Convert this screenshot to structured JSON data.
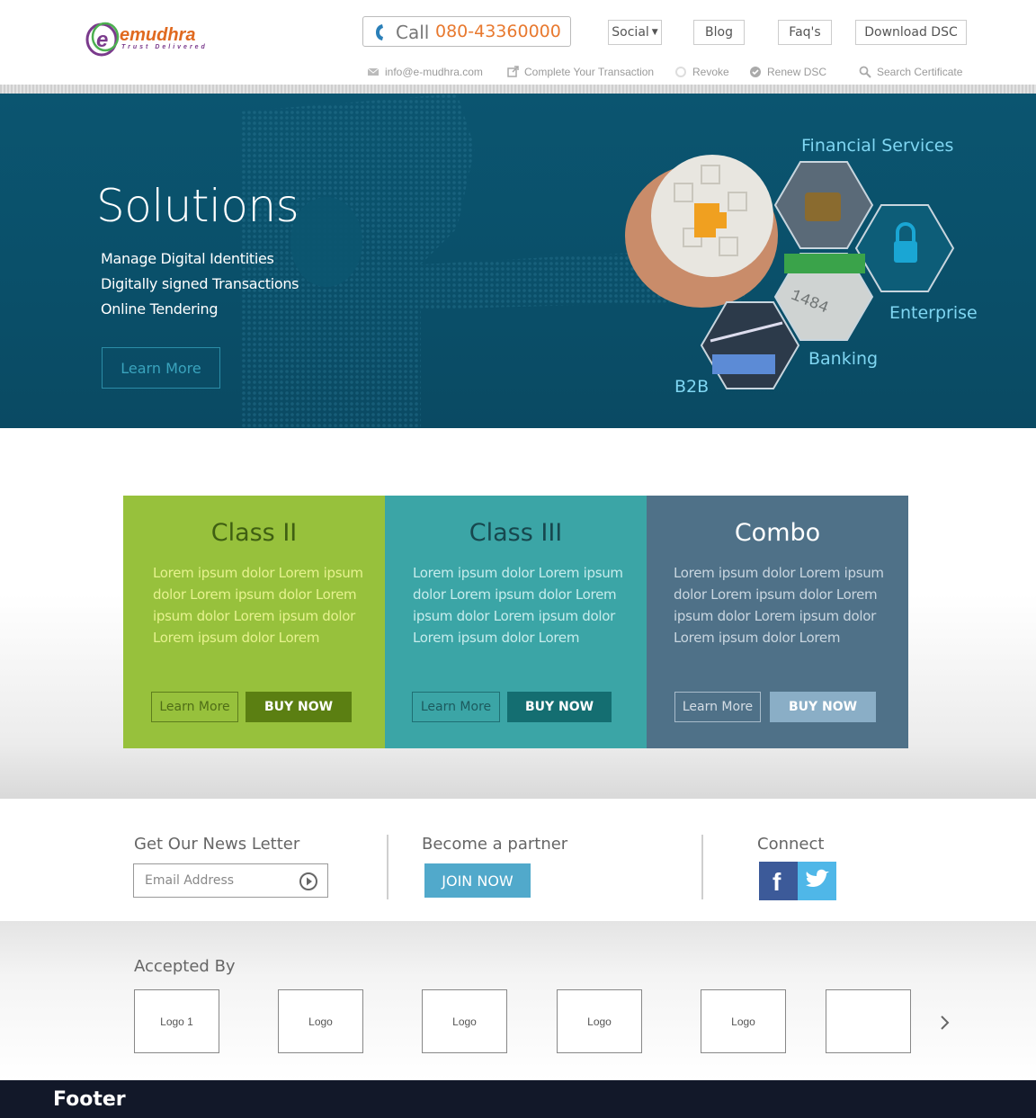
{
  "brand": {
    "name": "emudhra",
    "tagline": "Trust Delivered",
    "letter": "e"
  },
  "header": {
    "call_label": "Call",
    "call_number": "080-43360000",
    "nav": [
      "Social",
      "Blog",
      "Faq's",
      "Download DSC"
    ],
    "subnav": {
      "email": "info@e-mudhra.com",
      "complete": "Complete Your Transaction",
      "revoke": "Revoke",
      "renew": "Renew DSC",
      "search": "Search Certificate"
    }
  },
  "hero": {
    "title": "Solutions",
    "items": [
      "Manage Digital Identities",
      "Digitally signed Transactions",
      "Online Tendering"
    ],
    "button": "Learn More",
    "labels": {
      "financial": "Financial Services",
      "enterprise": "Enterprise",
      "banking": "Banking",
      "b2b": "B2B"
    },
    "card_digits": "1484"
  },
  "plans": [
    {
      "title": "Class II",
      "text": "Lorem ipsum dolor Lorem ipsum dolor Lorem ipsum dolor Lorem ipsum dolor Lorem ipsum dolor Lorem ipsum dolor Lorem",
      "learn": "Learn More",
      "buy": "BUY NOW"
    },
    {
      "title": "Class III",
      "text": "Lorem ipsum dolor Lorem ipsum dolor Lorem ipsum dolor Lorem ipsum dolor Lorem ipsum dolor Lorem ipsum dolor Lorem",
      "learn": "Learn More",
      "buy": "BUY NOW"
    },
    {
      "title": "Combo",
      "text": "Lorem ipsum dolor Lorem ipsum dolor Lorem ipsum dolor Lorem ipsum dolor Lorem ipsum dolor Lorem ipsum dolor Lorem",
      "learn": "Learn More",
      "buy": "BUY NOW"
    }
  ],
  "newsletter": {
    "title": "Get Our News Letter",
    "placeholder": "Email Address"
  },
  "partner": {
    "title": "Become a partner",
    "button": "JOIN NOW"
  },
  "connect": {
    "title": "Connect",
    "facebook_glyph": "f"
  },
  "accepted": {
    "title": "Accepted By",
    "logos": [
      "Logo 1",
      "Logo",
      "Logo",
      "Logo",
      "Logo",
      ""
    ]
  },
  "footer": {
    "label": "Footer"
  },
  "colors": {
    "accent_orange": "#e8792f",
    "hero_bg": "#0b5570",
    "class2": "#97c13c",
    "class3": "#3ba5a6",
    "combo": "#4f7188",
    "join": "#51a9cb",
    "footer_bg": "#121829"
  }
}
